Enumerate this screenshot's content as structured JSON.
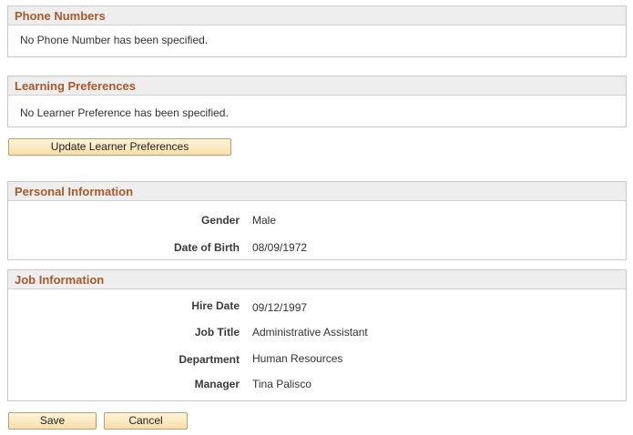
{
  "phone_numbers": {
    "title": "Phone Numbers",
    "empty_text": "No Phone Number has been specified."
  },
  "learning_preferences": {
    "title": "Learning Preferences",
    "empty_text": "No Learner Preference has been specified.",
    "update_button": "Update Learner Preferences"
  },
  "personal_information": {
    "title": "Personal Information",
    "fields": [
      {
        "label": "Gender",
        "value": "Male"
      },
      {
        "label": "Date of Birth",
        "value": "08/09/1972"
      }
    ]
  },
  "job_information": {
    "title": "Job Information",
    "fields": [
      {
        "label": "Hire Date",
        "value": "09/12/1997"
      },
      {
        "label": "Job Title",
        "value": "Administrative Assistant"
      },
      {
        "label": "Department",
        "value": "Human Resources"
      },
      {
        "label": "Manager",
        "value": "Tina Palisco"
      }
    ]
  },
  "actions": {
    "save_label": "Save",
    "cancel_label": "Cancel"
  },
  "colors": {
    "section_title": "#a9592a",
    "header_bg": "#eeeeee",
    "button_bg": "#f6dfa9"
  }
}
